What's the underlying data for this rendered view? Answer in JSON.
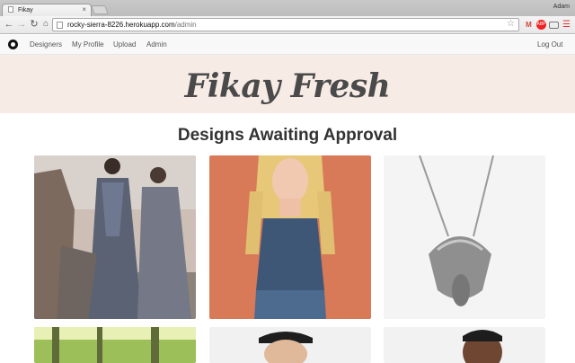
{
  "browser": {
    "tab_title": "Fikay",
    "tab_close": "×",
    "profile_name": "Adam",
    "url_host": "rocky-sierra-8226.herokuapp.com",
    "url_path": "/admin"
  },
  "nav": {
    "items": [
      "Designers",
      "My Profile",
      "Upload",
      "Admin"
    ],
    "logout": "Log Out"
  },
  "hero": {
    "title": "Fikay Fresh"
  },
  "main": {
    "heading": "Designs Awaiting Approval"
  },
  "designs": [
    {
      "subject": "women-in-lace-gowns"
    },
    {
      "subject": "woman-blue-beaded-top"
    },
    {
      "subject": "eagle-pendant-necklace"
    },
    {
      "subject": "forest-print"
    },
    {
      "subject": "man-cap-portrait"
    },
    {
      "subject": "man-portrait"
    }
  ],
  "colors": {
    "hero_bg": "#f7ebe6",
    "gmail_red": "#d44638",
    "abp_red": "#e22",
    "menu_red": "#d33"
  }
}
